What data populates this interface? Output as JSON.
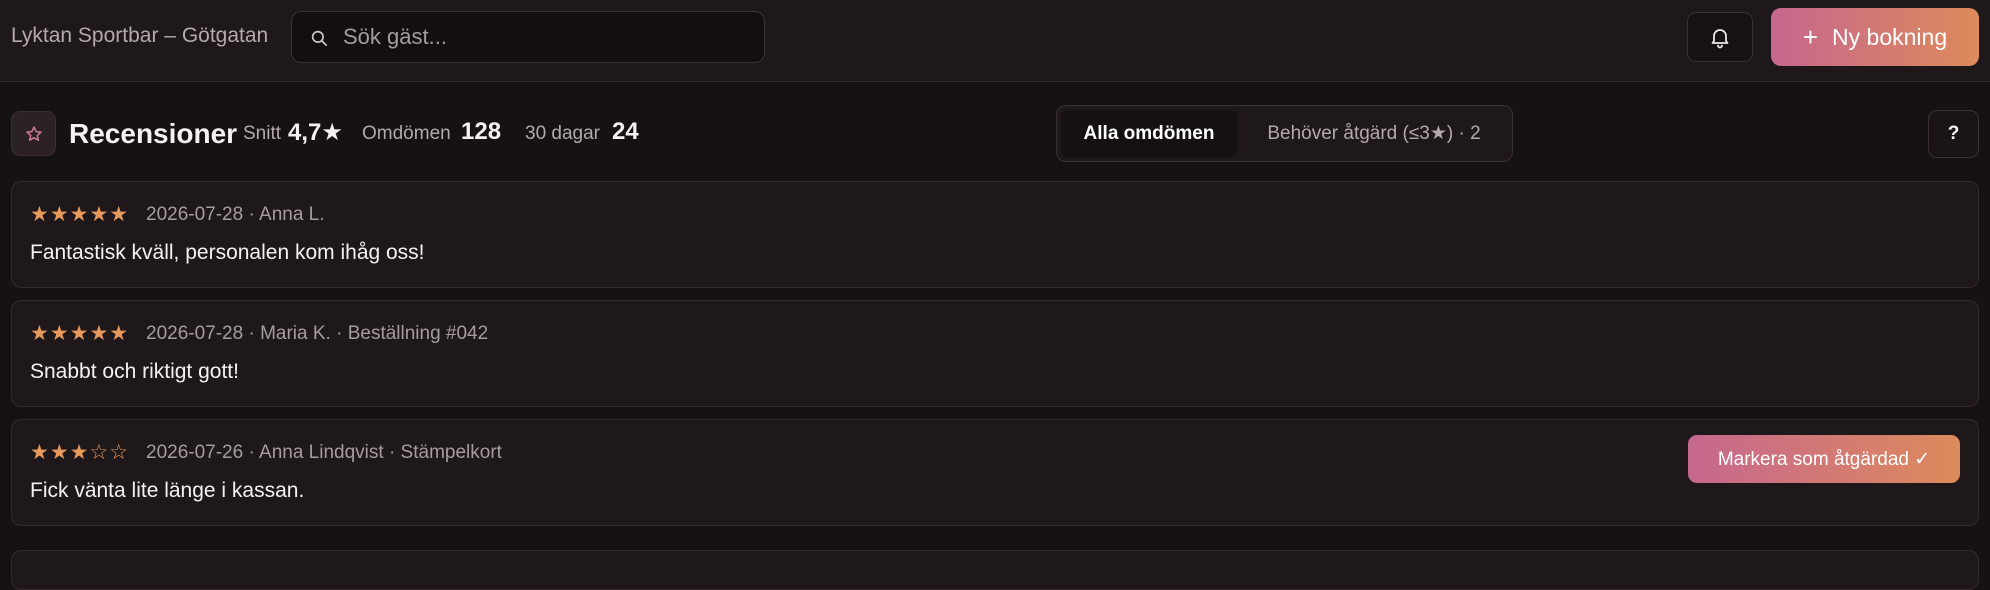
{
  "header": {
    "venue": "Lyktan Sportbar – Götgatan",
    "search_placeholder": "Sök gäst...",
    "new_booking_label": "Ny bokning"
  },
  "reviews_header": {
    "title": "Recensioner",
    "avg_label": "Snitt",
    "avg_value": "4,7★",
    "count_label": "Omdömen",
    "count_value": "128",
    "days_label": "30 dagar",
    "days_value": "24"
  },
  "filter_tabs": {
    "all": "Alla omdömen",
    "needs_action": "Behöver åtgärd (≤3★) · 2",
    "selected": "all"
  },
  "help_label": "?",
  "reviews": [
    {
      "rating": 5,
      "stars": "★★★★★",
      "meta": "2026-07-28 · Anna L.",
      "text": "Fantastisk kväll, personalen kom ihåg oss!"
    },
    {
      "rating": 5,
      "stars": "★★★★★",
      "meta": "2026-07-28 · Maria K. · Beställning #042",
      "text": "Snabbt och riktigt gott!"
    },
    {
      "rating": 3,
      "stars": "★★★☆☆",
      "meta": "2026-07-26 · Anna Lindqvist · Stämpelkort",
      "text": "Fick vänta lite länge i kassan.",
      "action_label": "Markera som åtgärdad ✓"
    }
  ],
  "colors": {
    "accent_start": "#c6678f",
    "accent_end": "#dd8a5b",
    "star": "#e8995c",
    "background": "#161113"
  },
  "icons": {
    "search": "search-icon",
    "bell": "bell-icon",
    "star": "star-outline-icon",
    "plus": "plus-icon"
  }
}
